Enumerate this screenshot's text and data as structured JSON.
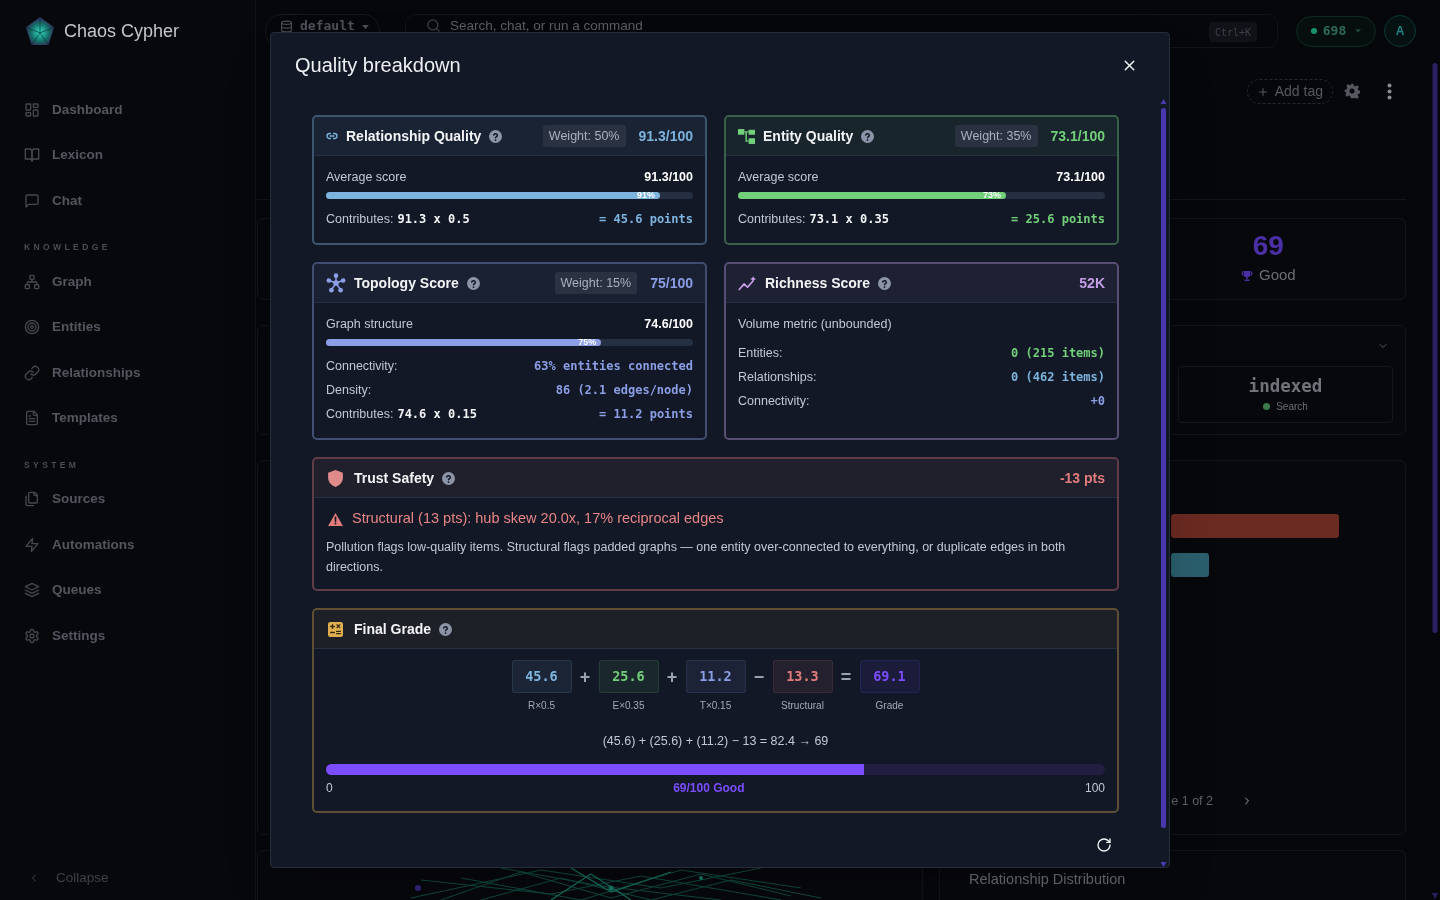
{
  "app": {
    "brand": "Chaos Cypher"
  },
  "sidebar": {
    "groups": [
      {
        "items": [
          {
            "label": "Dashboard",
            "selected": false
          },
          {
            "label": "Lexicon",
            "selected": false
          },
          {
            "label": "Chat",
            "selected": false
          }
        ]
      },
      {
        "heading": "KNOWLEDGE",
        "items": [
          {
            "label": "Graph",
            "selected": false
          },
          {
            "label": "Entities",
            "selected": false
          },
          {
            "label": "Relationships",
            "selected": false
          },
          {
            "label": "Templates",
            "selected": false
          }
        ]
      },
      {
        "heading": "SYSTEM",
        "items": [
          {
            "label": "Sources",
            "selected": false
          },
          {
            "label": "Automations",
            "selected": false
          },
          {
            "label": "Queues",
            "selected": false
          },
          {
            "label": "Settings",
            "selected": false
          }
        ]
      }
    ],
    "collapse": "Collapse"
  },
  "topbar": {
    "workspace": "default",
    "search": {
      "placeholder": "Search, chat, or run a command",
      "shortcut": "Ctrl+K"
    },
    "credits": "698",
    "avatar": "A"
  },
  "page": {
    "add_tag": "Add tag",
    "score_card": {
      "value": "69",
      "label": "Good"
    },
    "index_card": {
      "value": "indexed",
      "label": "Search"
    },
    "pagination": "e 1 of 2",
    "distribution_title": "Relationship Distribution"
  },
  "modal": {
    "title": "Quality breakdown",
    "metrics": [
      {
        "kind": "weighted",
        "title": "Relationship Quality",
        "weight": "Weight: 50%",
        "score": "91.3/100",
        "color": "#7db4de",
        "metric_label": "Average score",
        "metric_value": "91.3/100",
        "level": 0.91,
        "bar_label": "91%",
        "contributes": {
          "label": "Contributes:",
          "formula": "91.3 x 0.5",
          "result": "= 45.6 points"
        }
      },
      {
        "kind": "weighted",
        "title": "Entity Quality",
        "weight": "Weight: 35%",
        "score": "73.1/100",
        "color": "#72cf7a",
        "metric_label": "Average score",
        "metric_value": "73.1/100",
        "level": 0.73,
        "bar_label": "73%",
        "contributes": {
          "label": "Contributes:",
          "formula": "73.1 x 0.35",
          "result": "= 25.6 points"
        }
      },
      {
        "kind": "weighted",
        "title": "Topology Score",
        "weight": "Weight: 15%",
        "score": "75/100",
        "color": "#8c9ee6",
        "metric_label": "Graph structure",
        "metric_value": "74.6/100",
        "level": 0.75,
        "bar_label": "75%",
        "details": [
          {
            "label": "Connectivity:",
            "value": "63% entities connected"
          },
          {
            "label": "Density:",
            "value": "86 (2.1 edges/node)"
          }
        ],
        "contributes": {
          "label": "Contributes:",
          "formula": "74.6 x 0.15",
          "result": "= 11.2 points"
        }
      },
      {
        "kind": "volume",
        "title": "Richness Score",
        "score": "52K",
        "color": "#c49de6",
        "subtitle": "Volume metric (unbounded)",
        "details": [
          {
            "label": "Entities:",
            "value": "0 (215 items)",
            "color": "#72cf7a"
          },
          {
            "label": "Relationships:",
            "value": "0 (462 items)",
            "color": "#7db4de"
          },
          {
            "label": "Connectivity:",
            "value": "+0",
            "color": "#8c9ee6"
          }
        ]
      }
    ],
    "trust": {
      "title": "Trust Safety",
      "score": "-13 pts",
      "warning": "Structural (13 pts): hub skew 20.0x, 17% reciprocal edges",
      "note": "Pollution flags low-quality items. Structural flags padded graphs — one entity over-connected to everything, or duplicate edges in both directions."
    },
    "final": {
      "title": "Final Grade",
      "equation": [
        {
          "kind": "term",
          "value": "45.6",
          "label": "R×0.5",
          "color": "#7db4de"
        },
        {
          "kind": "operator",
          "symbol": "+"
        },
        {
          "kind": "term",
          "value": "25.6",
          "label": "E×0.35",
          "color": "#72cf7a"
        },
        {
          "kind": "operator",
          "symbol": "+"
        },
        {
          "kind": "term",
          "value": "11.2",
          "label": "T×0.15",
          "color": "#8c9ee6"
        },
        {
          "kind": "operator",
          "symbol": "−"
        },
        {
          "kind": "term",
          "value": "13.3",
          "label": "Structural",
          "color": "#e07c7c"
        },
        {
          "kind": "operator",
          "symbol": "="
        },
        {
          "kind": "term",
          "value": "69.1",
          "label": "Grade",
          "color": "#7c4dff"
        }
      ],
      "formula": "(45.6) + (25.6) + (11.2) − 13 = 82.4 → 69",
      "bar": {
        "level": 0.69,
        "min": "0",
        "label": "69/100 Good",
        "max": "100"
      }
    }
  }
}
